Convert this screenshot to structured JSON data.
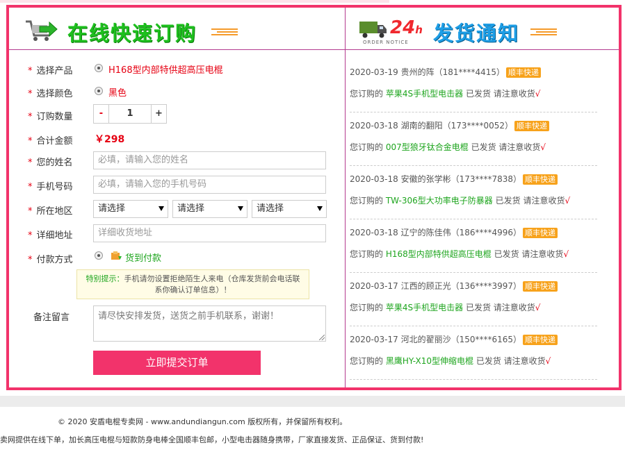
{
  "left_panel": {
    "title": "在线快速订购",
    "labels": {
      "product": "选择产品",
      "color": "选择颜色",
      "quantity": "订购数量",
      "total": "合计金额",
      "name": "您的姓名",
      "phone": "手机号码",
      "region": "所在地区",
      "address": "详细地址",
      "payment": "付款方式",
      "remark": "备注留言"
    },
    "required_mark": "*",
    "product_option": "H168型内部特供超高压电棍",
    "color_option": "黑色",
    "quantity": {
      "minus": "-",
      "value": "1",
      "plus": "+"
    },
    "total_price": "￥298",
    "name_placeholder": "必填，请输入您的姓名",
    "phone_placeholder": "必填，请输入您的手机号码",
    "region_selects": [
      "请选择",
      "请选择",
      "请选择"
    ],
    "address_placeholder": "详细收货地址",
    "payment_option": "货到付款",
    "tip": {
      "key": "特别提示：",
      "text": "手机请勿设置拒绝陌生人来电（仓库发货前会电话联系你确认订单信息）！"
    },
    "remark_value": "请尽快安排发货，送货之前手机联系，谢谢！",
    "submit_label": "立即提交订单"
  },
  "right_panel": {
    "hours": "24",
    "hours_unit": "h",
    "subtitle": "ORDER NOTICE",
    "title": "发货通知",
    "badge_label": "顺丰快递",
    "order_prefix": "您订购的",
    "order_suffix": "已发货 请注意收货",
    "check": "√",
    "notices": [
      {
        "date": "2020-03-19",
        "who": "贵州的阵",
        "phone": "（181****4415）",
        "product": "苹果4S手机型电击器"
      },
      {
        "date": "2020-03-18",
        "who": "湖南的翻阳",
        "phone": "（173****0052）",
        "product": "007型狼牙钛合金电棍"
      },
      {
        "date": "2020-03-18",
        "who": "安徽的张学彬",
        "phone": "（173****7838）",
        "product": "TW-306型大功率电子防暴器"
      },
      {
        "date": "2020-03-18",
        "who": "辽宁的陈佳伟",
        "phone": "（186****4996）",
        "product": "H168型内部特供超高压电棍"
      },
      {
        "date": "2020-03-17",
        "who": "江西的顾正光",
        "phone": "（136****3997）",
        "product": "苹果4S手机型电击器"
      },
      {
        "date": "2020-03-17",
        "who": "河北的翟丽沙",
        "phone": "（150****6165）",
        "product": "黑鹰HY-X10型伸缩电棍"
      }
    ]
  },
  "footer": {
    "copyright": "© 2020 安盾电棍专卖网 - www.andundiangun.com 版权所有，并保留所有权利。",
    "description": "卖网提供在线下单，加长高压电棍与短款防身电棒全国顺丰包邮，小型电击器随身携带，厂家直接发货、正品保证、货到付款!"
  },
  "colors": {
    "accent": "#f2336b",
    "green": "#1ec01e",
    "blue": "#1e9ee6",
    "badge": "#f7a21b",
    "red": "#e60012"
  }
}
